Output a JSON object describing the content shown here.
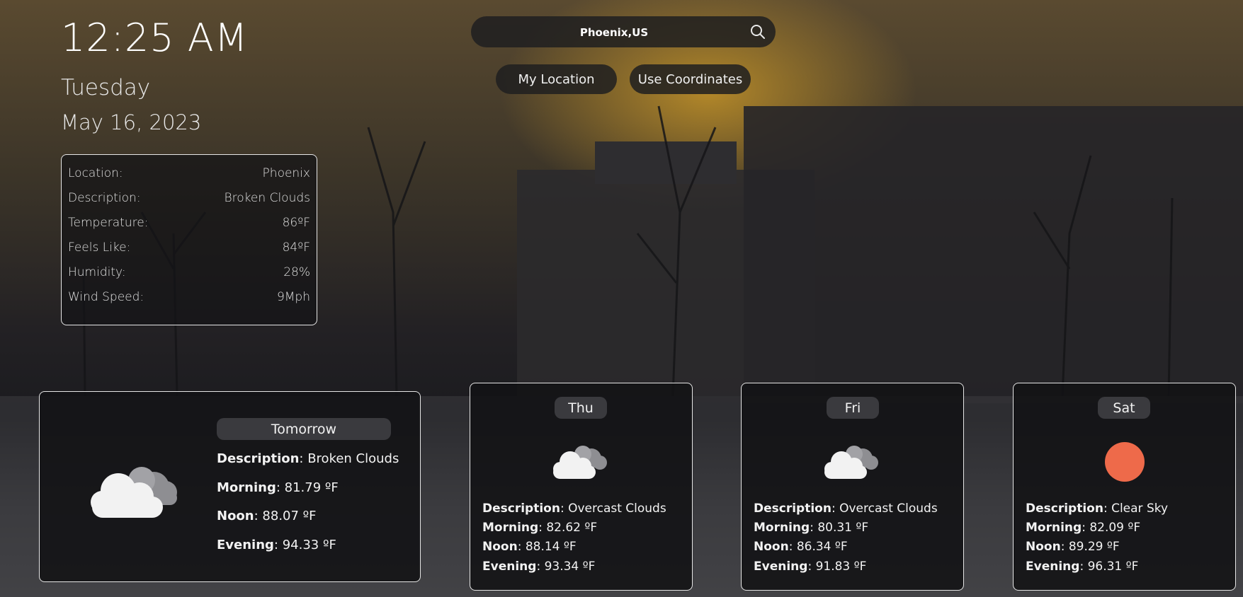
{
  "clock": {
    "time": "12:25 AM",
    "weekday": "Tuesday",
    "date": "May 16, 2023"
  },
  "search": {
    "value": "Phoenix,US",
    "placeholder": ""
  },
  "buttons": {
    "my_location": "My Location",
    "use_coordinates": "Use Coordinates"
  },
  "current": {
    "rows": [
      {
        "label": "Location:",
        "value": "Phoenix"
      },
      {
        "label": "Description:",
        "value": "Broken Clouds"
      },
      {
        "label": "Temperature:",
        "value": "86ºF"
      },
      {
        "label": "Feels Like:",
        "value": "84ºF"
      },
      {
        "label": "Humidity:",
        "value": "28%"
      },
      {
        "label": "Wind Speed:",
        "value": "9Mph"
      }
    ]
  },
  "labels": {
    "description": "Description",
    "morning": "Morning",
    "noon": "Noon",
    "evening": "Evening"
  },
  "forecast": [
    {
      "day": "Tomorrow",
      "icon": "broken-clouds-icon",
      "description": ": Broken Clouds",
      "morning": ": 81.79 ºF",
      "noon": ": 88.07 ºF",
      "evening": ": 94.33 ºF"
    },
    {
      "day": "Thu",
      "icon": "overcast-clouds-icon",
      "description": ": Overcast Clouds",
      "morning": ": 82.62 ºF",
      "noon": ": 88.14 ºF",
      "evening": ": 93.34 ºF"
    },
    {
      "day": "Fri",
      "icon": "overcast-clouds-icon",
      "description": ": Overcast Clouds",
      "morning": ": 80.31 ºF",
      "noon": ": 86.34 ºF",
      "evening": ": 91.83 ºF"
    },
    {
      "day": "Sat",
      "icon": "sun-icon",
      "description": ": Clear Sky",
      "morning": ": 82.09 ºF",
      "noon": ": 89.29 ºF",
      "evening": ": 96.31 ºF"
    }
  ],
  "colors": {
    "sun": "#ee6a4a",
    "cloud": "#f2f2f2",
    "cloud_back": "#9a9a9e",
    "tag": "#3a3a3e"
  }
}
